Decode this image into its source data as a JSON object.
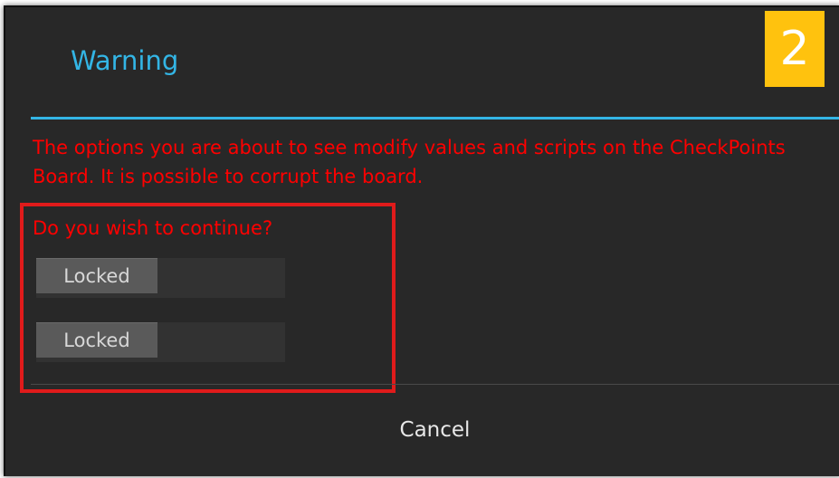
{
  "dialog": {
    "title": "Warning",
    "step_badge": "2",
    "message": "The options you are about to see modify values and scripts on the CheckPoints Board.  It is possible to corrupt the board.",
    "question": "Do you wish to continue?",
    "toggles": [
      {
        "label": "Locked"
      },
      {
        "label": "Locked"
      }
    ],
    "cancel_label": "Cancel"
  },
  "colors": {
    "title": "#33b5e5",
    "warning_text": "#ff0000",
    "badge": "#ffc20e",
    "highlight": "#e01b1b",
    "background": "#282828"
  }
}
